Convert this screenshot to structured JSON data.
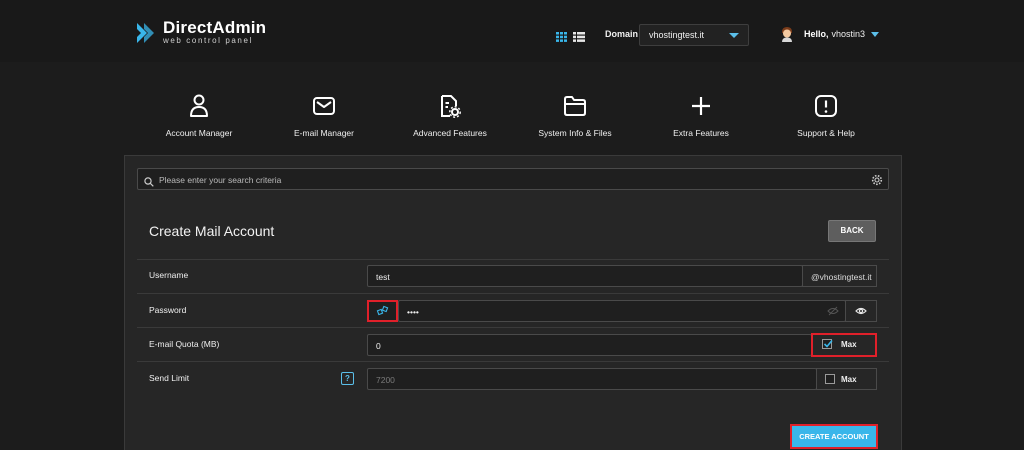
{
  "app": {
    "logo_title": "DirectAdmin",
    "logo_subtitle": "web control panel"
  },
  "header": {
    "domain_label": "Domain",
    "domain_value": "vhostingtest.it",
    "greeting": "Hello,",
    "username": "vhostin3"
  },
  "nav": {
    "items": [
      {
        "label": "Account Manager",
        "icon": "user-icon"
      },
      {
        "label": "E-mail Manager",
        "icon": "envelope-icon"
      },
      {
        "label": "Advanced Features",
        "icon": "file-gear-icon"
      },
      {
        "label": "System Info & Files",
        "icon": "folder-icon"
      },
      {
        "label": "Extra Features",
        "icon": "plus-icon"
      },
      {
        "label": "Support & Help",
        "icon": "alert-icon"
      }
    ]
  },
  "search": {
    "placeholder": "Please enter your search criteria"
  },
  "form": {
    "title": "Create Mail Account",
    "back_label": "BACK",
    "username_label": "Username",
    "username_value": "test",
    "domain_suffix": "@vhostingtest.it",
    "password_label": "Password",
    "password_value": "••••",
    "quota_label": "E-mail Quota (MB)",
    "quota_value": "0",
    "quota_max_label": "Max",
    "quota_max_checked": true,
    "send_limit_label": "Send Limit",
    "send_limit_help": "?",
    "send_limit_value": "7200",
    "send_limit_max_label": "Max",
    "send_limit_max_checked": false,
    "create_label": "CREATE ACCOUNT"
  },
  "colors": {
    "accent": "#39b6ea",
    "highlight": "#e0202a",
    "background": "#1c1c1c",
    "panel": "#262626"
  }
}
